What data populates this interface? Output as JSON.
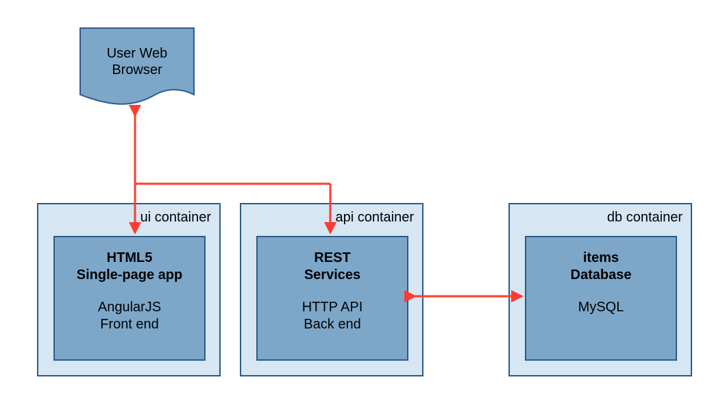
{
  "browser": {
    "line1": "User Web",
    "line2": "Browser"
  },
  "containers": {
    "ui": {
      "label": "ui      container",
      "title_line1": "HTML5",
      "title_line2": "Single-page app",
      "sub_line1": "AngularJS",
      "sub_line2": "Front end"
    },
    "api": {
      "label": "api     container",
      "title_line1": "REST",
      "title_line2": "Services",
      "sub_line1": "HTTP API",
      "sub_line2": "Back end"
    },
    "db": {
      "label": "db container",
      "title_line1": "items",
      "title_line2": "Database",
      "sub_line1": "MySQL",
      "sub_line2": ""
    }
  },
  "colors": {
    "container_fill": "#d6e6f2",
    "box_fill": "#7da7c9",
    "border": "#2d5a8a",
    "arrow": "#ff3b2f"
  }
}
